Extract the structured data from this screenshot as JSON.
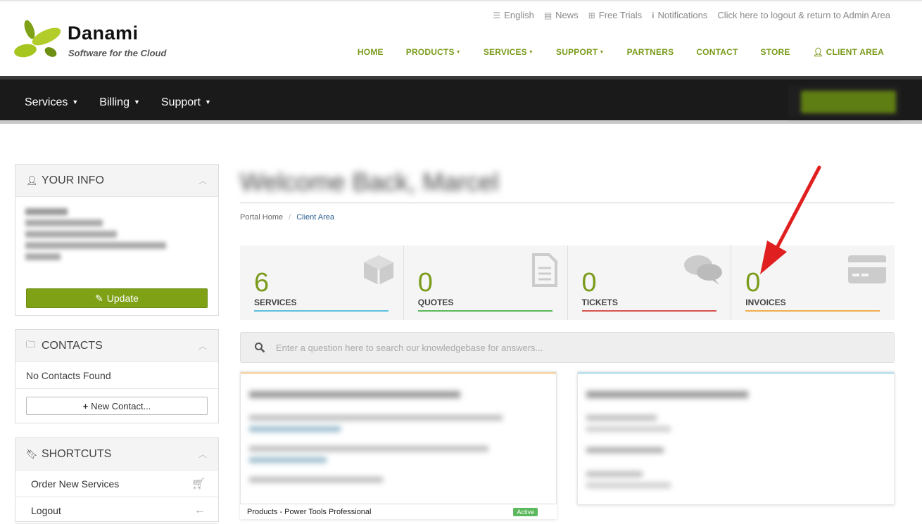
{
  "brand": {
    "name": "Danami",
    "tagline": "Software for the Cloud"
  },
  "top_links": [
    {
      "icon": "menu-icon",
      "label": "English"
    },
    {
      "icon": "newspaper-icon",
      "label": "News"
    },
    {
      "icon": "gift-icon",
      "label": "Free Trials"
    },
    {
      "icon": "info-icon",
      "label": "Notifications"
    },
    {
      "icon": "",
      "label": "Click here to logout & return to Admin Area"
    }
  ],
  "main_nav": [
    "HOME",
    "PRODUCTS",
    "SERVICES",
    "SUPPORT",
    "PARTNERS",
    "CONTACT",
    "STORE",
    "CLIENT AREA"
  ],
  "dark_nav": [
    "Services",
    "Billing",
    "Support"
  ],
  "sidebar": {
    "your_info": {
      "title": "YOUR INFO",
      "update_label": "Update"
    },
    "contacts": {
      "title": "CONTACTS",
      "empty_text": "No Contacts Found",
      "new_label": "New Contact..."
    },
    "shortcuts": {
      "title": "SHORTCUTS",
      "items": [
        "Order New Services",
        "Logout"
      ]
    }
  },
  "main": {
    "welcome": "Welcome Back, Marcel",
    "breadcrumb": {
      "home": "Portal Home",
      "current": "Client Area"
    },
    "tiles": [
      {
        "count": "6",
        "label": "SERVICES",
        "color": "#5bc0de",
        "icon": "cube-icon"
      },
      {
        "count": "0",
        "label": "QUOTES",
        "color": "#5cb85c",
        "icon": "document-icon"
      },
      {
        "count": "0",
        "label": "TICKETS",
        "color": "#d9534f",
        "icon": "comments-icon"
      },
      {
        "count": "0",
        "label": "INVOICES",
        "color": "#f0ad4e",
        "icon": "credit-card-icon"
      }
    ],
    "search_placeholder": "Enter a question here to search our knowledgebase for answers...",
    "visible_product": {
      "name": "Products - Power Tools Professional",
      "status": "Active"
    }
  },
  "colors": {
    "accent": "#7a9b1b",
    "dark_bar": "#1a1a1a",
    "annotation_arrow": "#e02020"
  }
}
